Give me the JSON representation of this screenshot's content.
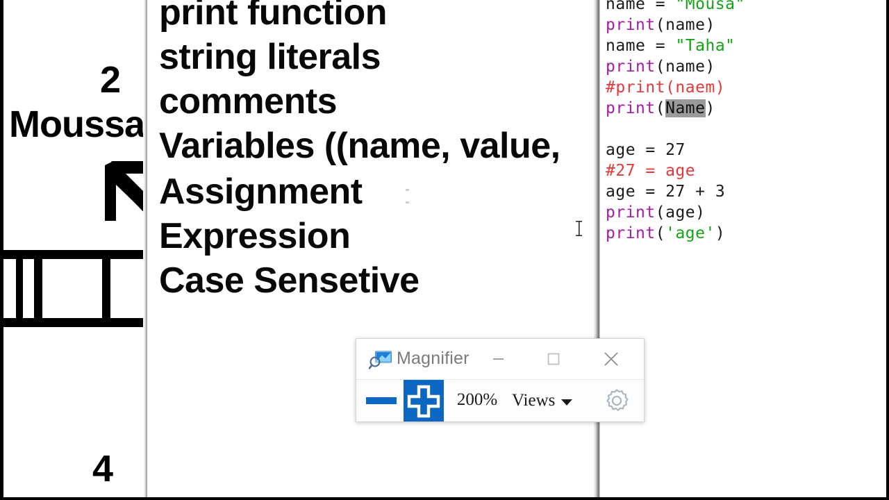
{
  "console_output": {
    "lines": [
      {
        "text": "2",
        "kind": "number"
      },
      {
        "text": "Moussa",
        "kind": "string"
      },
      {
        "text": "4",
        "kind": "number"
      }
    ],
    "cursor_icon": "mouse-arrow-cursor-icon",
    "selection_box_icon": "selection-rectangle-icon"
  },
  "notes": {
    "lines": [
      "print function",
      "string literals",
      "comments",
      "Variables ((name, value,",
      "Assignment",
      "Expression",
      "Case Sensetive"
    ],
    "text_cursor_icon": "i-beam-cursor-icon"
  },
  "code_editor": {
    "lines": [
      [
        {
          "t": "name = ",
          "c": "plain"
        },
        {
          "t": "\"Mousa\"",
          "c": "str"
        }
      ],
      [
        {
          "t": "print",
          "c": "fn"
        },
        {
          "t": "(name)",
          "c": "plain"
        }
      ],
      [
        {
          "t": "name = ",
          "c": "plain"
        },
        {
          "t": "\"Taha\"",
          "c": "str"
        }
      ],
      [
        {
          "t": "print",
          "c": "fn"
        },
        {
          "t": "(name)",
          "c": "plain"
        }
      ],
      [
        {
          "t": "#print(naem)",
          "c": "com"
        }
      ],
      [
        {
          "t": "print",
          "c": "fn"
        },
        {
          "t": "(",
          "c": "plain"
        },
        {
          "t": "Name",
          "c": "sel"
        },
        {
          "t": ")",
          "c": "plain"
        }
      ],
      [],
      [
        {
          "t": "age = ",
          "c": "plain"
        },
        {
          "t": "27",
          "c": "plain"
        }
      ],
      [
        {
          "t": "#27 = age",
          "c": "com"
        }
      ],
      [
        {
          "t": "age = 27 + 3",
          "c": "plain"
        }
      ],
      [
        {
          "t": "print",
          "c": "fn"
        },
        {
          "t": "(age)",
          "c": "plain"
        }
      ],
      [
        {
          "t": "print",
          "c": "fn"
        },
        {
          "t": "(",
          "c": "plain"
        },
        {
          "t": "'age'",
          "c": "str"
        },
        {
          "t": ")",
          "c": "plain"
        }
      ]
    ],
    "selected_text": "Name",
    "colors": {
      "function": "#a020a0",
      "string": "#13a413",
      "comment": "#e23a3a",
      "plain": "#1a1a1a",
      "selection": "#9a9a9a"
    }
  },
  "magnifier": {
    "title": "Magnifier",
    "app_icon": "magnifier-screen-icon",
    "window_controls": {
      "minimize": "minimize-icon",
      "maximize": "maximize-icon",
      "close": "close-icon"
    },
    "toolbar": {
      "zoom_out_icon": "minus-icon",
      "zoom_out_label": "Zoom out",
      "zoom_in_icon": "plus-icon",
      "zoom_in_label": "Zoom in",
      "zoom_level": "200%",
      "views_label": "Views",
      "views_caret_icon": "chevron-down-icon",
      "settings_icon": "gear-icon",
      "settings_label": "Settings"
    },
    "accent_color": "#0b67c2"
  }
}
